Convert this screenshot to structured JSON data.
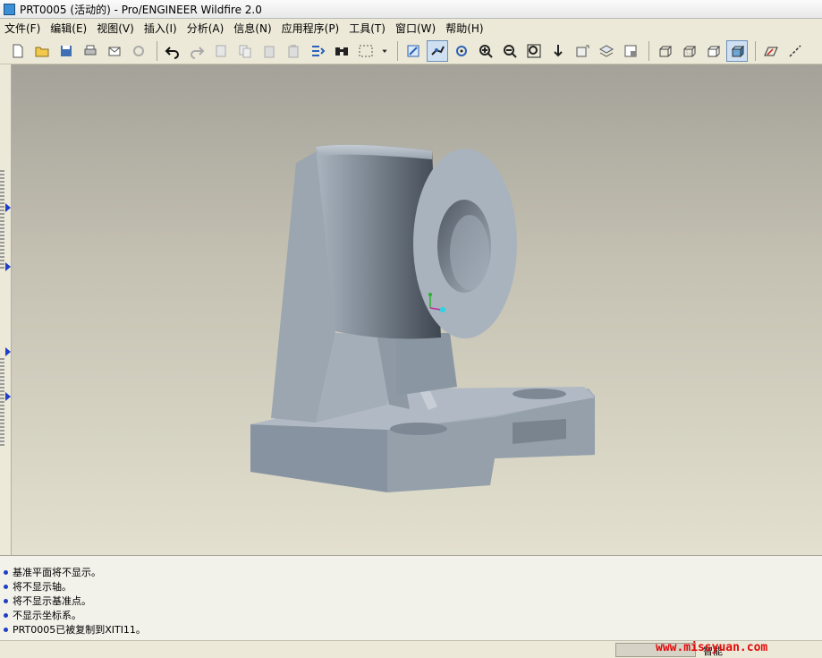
{
  "window": {
    "title": "PRT0005 (活动的) - Pro/ENGINEER Wildfire 2.0"
  },
  "menu": [
    {
      "label": "文件(F)"
    },
    {
      "label": "编辑(E)"
    },
    {
      "label": "视图(V)"
    },
    {
      "label": "插入(I)"
    },
    {
      "label": "分析(A)"
    },
    {
      "label": "信息(N)"
    },
    {
      "label": "应用程序(P)"
    },
    {
      "label": "工具(T)"
    },
    {
      "label": "窗口(W)"
    },
    {
      "label": "帮助(H)"
    }
  ],
  "toolbar": {
    "buttons": [
      "new-icon",
      "open-icon",
      "save-icon",
      "print-icon",
      "send-mail-icon",
      "send-link-icon",
      "undo-icon",
      "redo-icon",
      "cut-icon",
      "copy-icon",
      "paste-icon",
      "paste-special-icon",
      "regenerate-icon",
      "find-icon",
      "select-box-icon",
      "dropdown-icon",
      "datum-display-icon",
      "datum-axis-icon",
      "spin-center-icon",
      "zoom-in-icon",
      "zoom-out-icon",
      "refit-icon",
      "orient-icon",
      "saved-views-icon",
      "layers-icon",
      "view-manager-icon",
      "wireframe-icon",
      "hidden-line-icon",
      "no-hidden-icon",
      "shading-icon",
      "datum-plane-icon",
      "datum-axis-tool-icon"
    ]
  },
  "messages": [
    {
      "text": "基准平面将不显示。"
    },
    {
      "text": "将不显示轴。"
    },
    {
      "text": "将不显示基准点。"
    },
    {
      "text": "不显示坐标系。"
    },
    {
      "text": "PRT0005已被复制到XITI11。"
    }
  ],
  "status": {
    "filter": "智能"
  },
  "watermark": "www.missyuan.com",
  "colors": {
    "accent": "#3b6ea5",
    "model": "#8d99a5",
    "message_bullet": "#1f3fc4",
    "watermark": "#e20a0a"
  }
}
